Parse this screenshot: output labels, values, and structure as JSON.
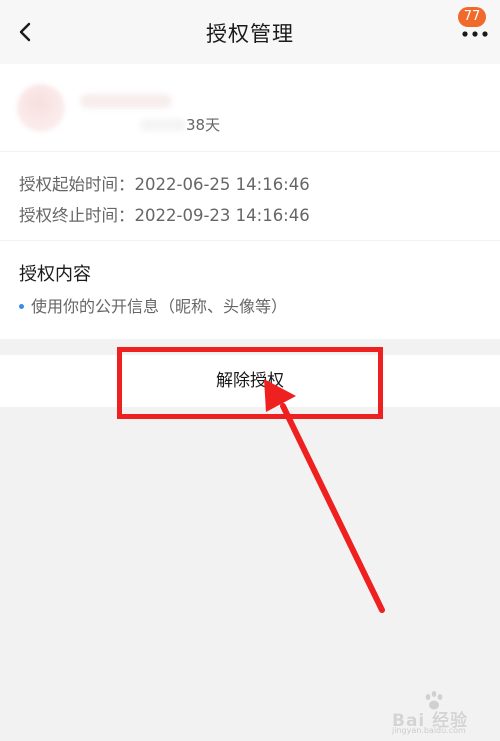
{
  "header": {
    "title": "授权管理",
    "badge_count": "77",
    "back_icon": "chevron-left-icon",
    "more_icon": "more-dots-icon"
  },
  "app": {
    "days_text": "38天"
  },
  "authorization": {
    "start_label": "授权起始时间：",
    "start_value": "2022-06-25 14:16:46",
    "end_label": "授权终止时间：",
    "end_value": "2022-09-23 14:16:46"
  },
  "content": {
    "title": "授权内容",
    "items": [
      "使用你的公开信息（昵称、头像等）"
    ]
  },
  "actions": {
    "revoke_label": "解除授权"
  },
  "watermark": {
    "text": "Bai 经验",
    "subtext": "jingyan.baidu.com"
  },
  "colors": {
    "badge": "#f06a2c",
    "annotation": "#ef2020",
    "bullet": "#3c8be8",
    "background": "#f2f2f2"
  }
}
